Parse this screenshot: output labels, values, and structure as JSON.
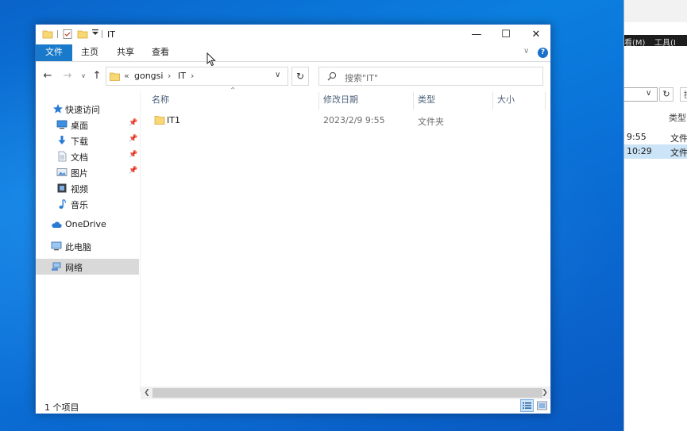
{
  "background_window": {
    "menu_items": [
      "看(M)",
      "工具(I"
    ],
    "search_stub": "搜",
    "column_header": "类型",
    "rows": [
      {
        "time": "9:55",
        "type": "文件"
      },
      {
        "time": "10:29",
        "type": "文件"
      }
    ]
  },
  "window": {
    "title": "IT",
    "caption": {
      "minimize": "—",
      "maximize": "☐",
      "close": "✕"
    }
  },
  "ribbon": {
    "tabs": [
      "文件",
      "主页",
      "共享",
      "查看"
    ],
    "expand_glyph": "∨",
    "help_glyph": "?"
  },
  "address": {
    "overflow": "«",
    "segments": [
      "gongsi",
      "IT"
    ],
    "chevron": "›",
    "dropdown": "∨",
    "refresh": "↻"
  },
  "nav_buttons": {
    "back": "←",
    "forward": "→",
    "recent": "∨",
    "up": "↑"
  },
  "search": {
    "placeholder": "搜索\"IT\""
  },
  "nav_pane": {
    "quick_access": {
      "label": "快速访问"
    },
    "pinned": [
      {
        "label": "桌面",
        "icon": "desktop-icon"
      },
      {
        "label": "下载",
        "icon": "download-icon"
      },
      {
        "label": "文档",
        "icon": "documents-icon"
      },
      {
        "label": "图片",
        "icon": "pictures-icon"
      }
    ],
    "unpinned": [
      {
        "label": "视频",
        "icon": "videos-icon"
      },
      {
        "label": "音乐",
        "icon": "music-icon"
      }
    ],
    "onedrive": {
      "label": "OneDrive"
    },
    "this_pc": {
      "label": "此电脑"
    },
    "network": {
      "label": "网络",
      "selected": true
    },
    "pin_glyph": "📌"
  },
  "columns": {
    "name": "名称",
    "date": "修改日期",
    "type": "类型",
    "size": "大小",
    "sort_caret": "⌃"
  },
  "files": [
    {
      "name": "IT1",
      "modified": "2023/2/9 9:55",
      "type": "文件夹",
      "size": ""
    }
  ],
  "status": {
    "item_count": "1 个项目"
  },
  "scroll": {
    "left": "❮",
    "right": "❯"
  },
  "colors": {
    "accent": "#1979ca",
    "desktop": "#0b7fe0",
    "folder": "#f8d775",
    "selected_nav": "#d9d9d9"
  }
}
